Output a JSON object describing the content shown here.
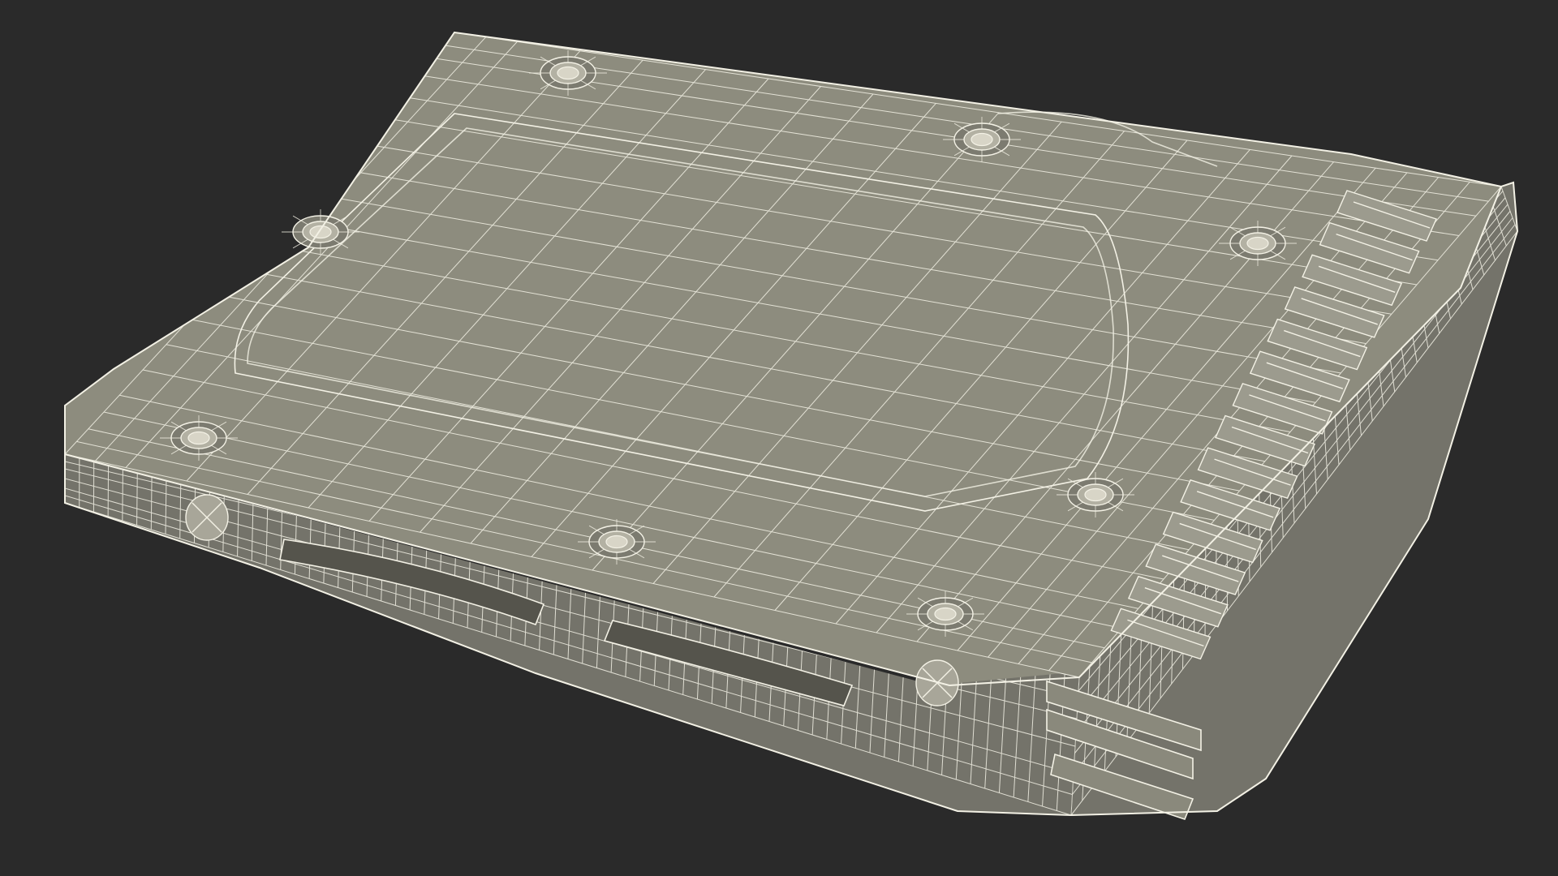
{
  "scene": {
    "background_color": "#2a2a2a",
    "surface_color": "#8d8c7e",
    "surface_shade_color": "#74736a",
    "wire_color": "#f3f1e5",
    "subject": "wireframe-3d-drive-caddy-model"
  }
}
